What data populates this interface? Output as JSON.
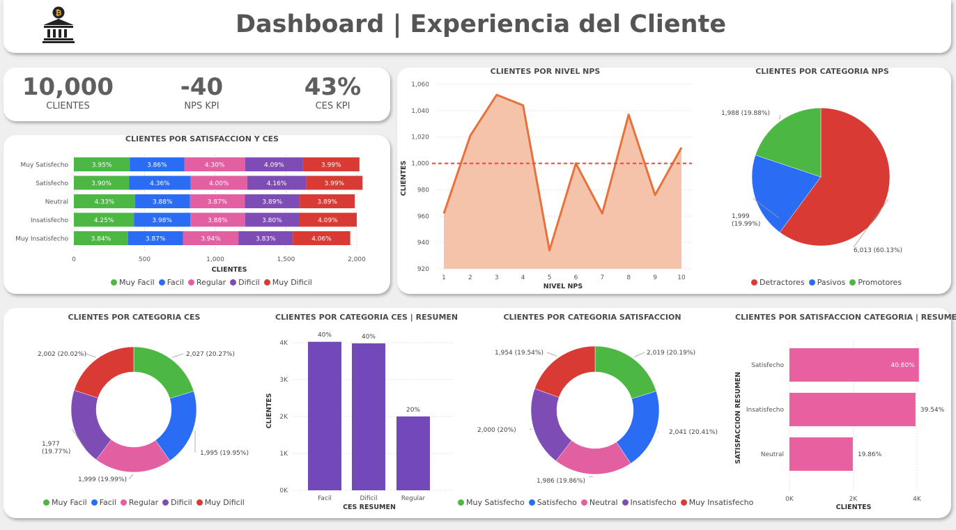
{
  "header": {
    "title": "Dashboard | Experiencia del Cliente",
    "logo_icon": "bank-bitcoin-icon"
  },
  "kpis": [
    {
      "value": "10,000",
      "label": "CLIENTES"
    },
    {
      "value": "-40",
      "label": "NPS KPI"
    },
    {
      "value": "43%",
      "label": "CES KPI"
    }
  ],
  "colors": {
    "green": "#4cb843",
    "blue": "#2a6df4",
    "pink": "#e25fa2",
    "purple": "#7d4db5",
    "red": "#d93a33",
    "orange": "#e8703a",
    "area": "#f5c3a9",
    "bar_purple": "#7348b8",
    "bar_pink": "#e8609f"
  },
  "charts": {
    "sat_ces": {
      "title": "CLIENTES POR SATISFACCION Y CES",
      "xlabel": "CLIENTES",
      "legend": [
        "Muy Facil",
        "Facil",
        "Regular",
        "Dificil",
        "Muy Dificil"
      ]
    },
    "nps_nivel": {
      "title": "CLIENTES POR NIVEL NPS",
      "xlabel": "NIVEL NPS",
      "ylabel": "CLIENTES"
    },
    "nps_cat": {
      "title": "CLIENTES POR CATEGORIA NPS",
      "legend": [
        "Detractores",
        "Pasivos",
        "Promotores"
      ]
    },
    "ces_cat": {
      "title": "CLIENTES POR CATEGORIA CES",
      "legend": [
        "Muy Facil",
        "Facil",
        "Regular",
        "Dificil",
        "Muy Dificil"
      ]
    },
    "ces_res": {
      "title": "CLIENTES POR CATEGORIA CES | RESUMEN",
      "xlabel": "CES RESUMEN",
      "ylabel": "CLIENTES"
    },
    "sat_cat": {
      "title": "CLIENTES POR CATEGORIA SATISFACCION",
      "legend": [
        "Muy Satisfecho",
        "Satisfecho",
        "Neutral",
        "Insatisfecho",
        "Muy Insatisfecho"
      ]
    },
    "sat_res": {
      "title": "CLIENTES POR SATISFACCION CATEGORIA | RESUMEN",
      "xlabel": "CLIENTES",
      "ylabel": "SATISFACCION RESUMEN"
    }
  },
  "chart_data": [
    {
      "type": "bar",
      "orientation": "horizontal-stacked",
      "categories": [
        "Muy Satisfecho",
        "Satisfecho",
        "Neutral",
        "Insatisfecho",
        "Muy Insatisfecho"
      ],
      "series": [
        {
          "name": "Muy Facil",
          "values": [
            395,
            390,
            433,
            425,
            384
          ],
          "labels": [
            "3.95%",
            "3.90%",
            "4.33%",
            "4.25%",
            "3.84%"
          ]
        },
        {
          "name": "Facil",
          "values": [
            386,
            436,
            388,
            398,
            387
          ],
          "labels": [
            "3.86%",
            "4.36%",
            "3.88%",
            "3.98%",
            "3.87%"
          ]
        },
        {
          "name": "Regular",
          "values": [
            430,
            400,
            387,
            388,
            394
          ],
          "labels": [
            "4.30%",
            "4.00%",
            "3.87%",
            "3.88%",
            "3.94%"
          ]
        },
        {
          "name": "Dificil",
          "values": [
            409,
            416,
            389,
            380,
            383
          ],
          "labels": [
            "4.09%",
            "4.16%",
            "3.89%",
            "3.80%",
            "3.83%"
          ]
        },
        {
          "name": "Muy Dificil",
          "values": [
            399,
            399,
            389,
            409,
            406
          ],
          "labels": [
            "3.99%",
            "3.99%",
            "3.89%",
            "4.09%",
            "4.06%"
          ]
        }
      ],
      "xticks": [
        "0",
        "500",
        "1,000",
        "1,500",
        "2,000"
      ],
      "xlim": [
        0,
        2000
      ]
    },
    {
      "type": "area",
      "x": [
        1,
        2,
        3,
        4,
        5,
        6,
        7,
        8,
        9,
        10
      ],
      "values": [
        962,
        1021,
        1052,
        1044,
        934,
        1000,
        962,
        1037,
        976,
        1012
      ],
      "reference_line": 1000,
      "ylim": [
        920,
        1060
      ],
      "yticks": [
        "920",
        "940",
        "960",
        "980",
        "1,000",
        "1,020",
        "1,040",
        "1,060"
      ]
    },
    {
      "type": "pie",
      "categories": [
        "Detractores",
        "Pasivos",
        "Promotores"
      ],
      "values": [
        6013,
        1999,
        1988
      ],
      "labels": [
        "6,013 (60.13%)",
        "1,999 (19.99%)",
        "1,988 (19.88%)"
      ]
    },
    {
      "type": "pie",
      "style": "donut",
      "categories": [
        "Muy Facil",
        "Facil",
        "Regular",
        "Dificil",
        "Muy Dificil"
      ],
      "values": [
        2027,
        1995,
        1999,
        1977,
        2002
      ],
      "labels": [
        "2,027 (20.27%)",
        "1,995 (19.95%)",
        "1,999 (19.99%)",
        "1,977 (19.77%)",
        "2,002 (20.02%)"
      ]
    },
    {
      "type": "bar",
      "categories": [
        "Facil",
        "Dificil",
        "Regular"
      ],
      "values": [
        4022,
        3979,
        1999
      ],
      "labels": [
        "40%",
        "40%",
        "20%"
      ],
      "yticks": [
        "0K",
        "1K",
        "2K",
        "3K",
        "4K"
      ],
      "ylim": [
        0,
        4300
      ]
    },
    {
      "type": "pie",
      "style": "donut",
      "categories": [
        "Muy Satisfecho",
        "Satisfecho",
        "Neutral",
        "Insatisfecho",
        "Muy Insatisfecho"
      ],
      "values": [
        2019,
        2041,
        1986,
        2000,
        1954
      ],
      "labels": [
        "2,019 (20.19%)",
        "2,041 (20.41%)",
        "1,986 (19.86%)",
        "2,000 (20%)",
        "1,954 (19.54%)"
      ]
    },
    {
      "type": "bar",
      "orientation": "horizontal",
      "categories": [
        "Satisfecho",
        "Insatisfecho",
        "Neutral"
      ],
      "values": [
        4060,
        3954,
        1986
      ],
      "labels": [
        "40.60%",
        "39.54%",
        "19.86%"
      ],
      "xticks": [
        "0K",
        "2K",
        "4K"
      ],
      "xlim": [
        0,
        4200
      ]
    }
  ]
}
